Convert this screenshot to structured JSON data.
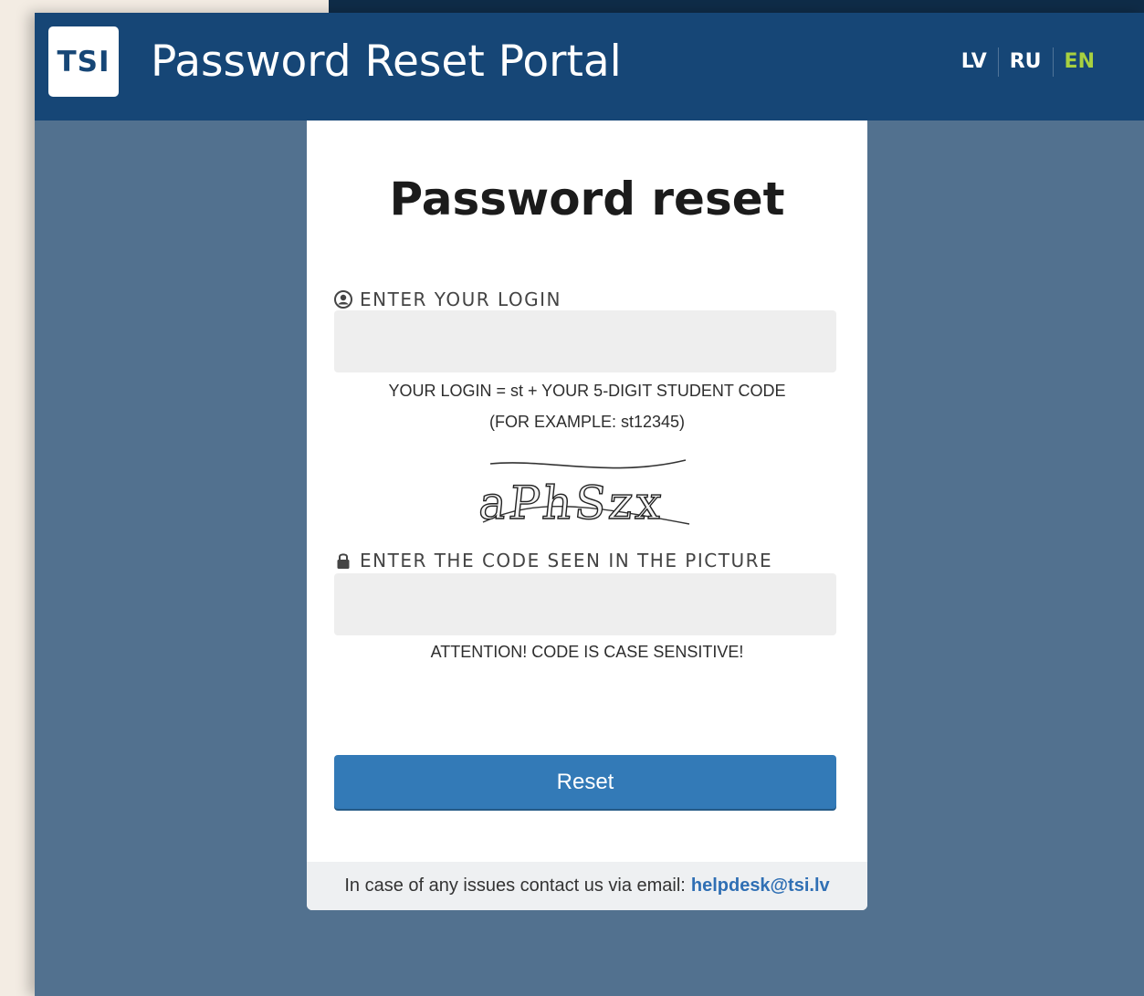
{
  "header": {
    "logo_text": "TSI",
    "title": "Password Reset Portal",
    "languages": [
      "LV",
      "RU",
      "EN"
    ],
    "active_language": "EN"
  },
  "form": {
    "title": "Password reset",
    "login_label": "ENTER YOUR LOGIN",
    "login_value": "",
    "login_hint_line1": "YOUR LOGIN = st + YOUR 5-DIGIT STUDENT CODE",
    "login_hint_line2": "(FOR EXAMPLE: st12345)",
    "captcha_text": "aPhSzx",
    "code_label": "ENTER THE CODE SEEN IN THE PICTURE",
    "code_value": "",
    "code_hint": "ATTENTION! CODE IS CASE SENSITIVE!",
    "reset_label": "Reset"
  },
  "footer": {
    "text": "In case of any issues contact us via email:",
    "email": "helpdesk@tsi.lv"
  },
  "icons": {
    "login": "user-circle-icon",
    "code": "lock-icon"
  },
  "colors": {
    "header_bg": "#164676",
    "page_bg": "#52718f",
    "button": "#337ab7",
    "active_lang": "#a7d040",
    "link": "#2f6fb4"
  }
}
